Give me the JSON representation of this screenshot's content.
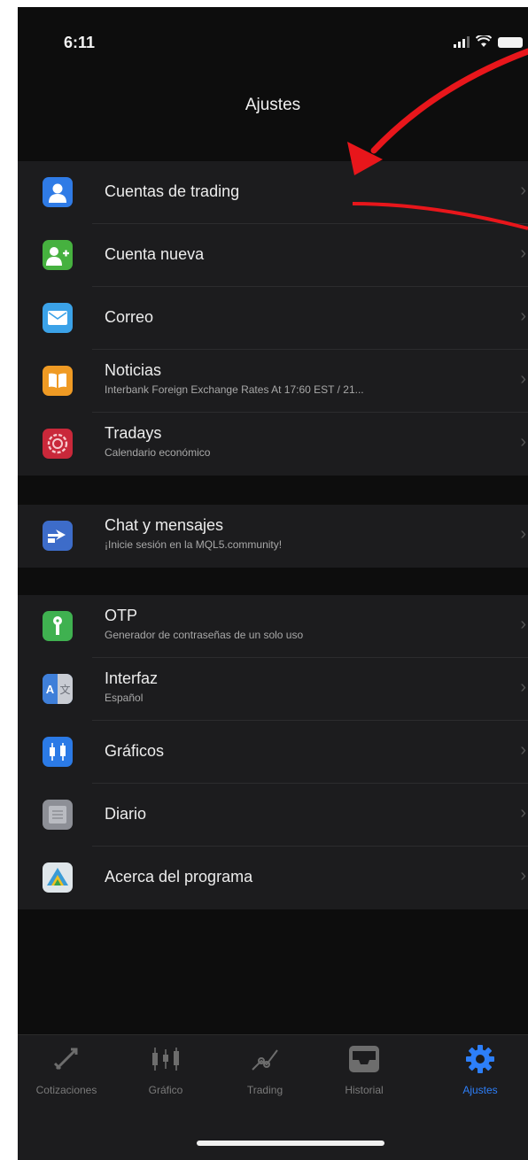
{
  "status_bar": {
    "time": "6:11"
  },
  "header": {
    "title": "Ajustes"
  },
  "groups": [
    {
      "items": [
        {
          "label": "Cuentas de trading",
          "icon": "person-icon",
          "color": "#2f7be6"
        },
        {
          "label": "Cuenta nueva",
          "icon": "add-person-icon",
          "color": "#46b13f"
        },
        {
          "label": "Correo",
          "icon": "envelope-icon",
          "color": "#3ba2e8"
        },
        {
          "label": "Noticias",
          "subtitle": "Interbank Foreign Exchange Rates At 17:60 EST / 21...",
          "icon": "book-icon",
          "color": "#ef9a24"
        },
        {
          "label": "Tradays",
          "subtitle": "Calendario económico",
          "icon": "tradays-icon",
          "color": "#c9283a"
        }
      ]
    },
    {
      "items": [
        {
          "label": "Chat y mensajes",
          "subtitle": "¡Inicie sesión en la MQL5.community!",
          "icon": "chat-icon",
          "color": "#3d6cc9"
        }
      ]
    },
    {
      "items": [
        {
          "label": "OTP",
          "subtitle": "Generador de contraseñas de un solo uso",
          "icon": "key-icon",
          "color": "#3fb150"
        },
        {
          "label": "Interfaz",
          "subtitle": "Español",
          "icon": "language-icon",
          "color": "#3f7fd9"
        },
        {
          "label": "Gráficos",
          "icon": "chart-icon",
          "color": "#2b7ae6"
        },
        {
          "label": "Diario",
          "icon": "journal-icon",
          "color": "#8d8f96"
        },
        {
          "label": "Acerca del programa",
          "icon": "app-logo-icon",
          "color": "#3a9bd6"
        }
      ]
    }
  ],
  "tab_bar": {
    "tabs": [
      {
        "label": "Cotizaciones",
        "icon": "quotes-icon"
      },
      {
        "label": "Gráfico",
        "icon": "candles-icon"
      },
      {
        "label": "Trading",
        "icon": "trading-icon"
      },
      {
        "label": "Historial",
        "icon": "inbox-icon"
      },
      {
        "label": "Ajustes",
        "icon": "gear-icon",
        "active": true
      }
    ]
  },
  "colors": {
    "accent": "#2d7ff9",
    "annotation_arrow": "#e8161b"
  }
}
